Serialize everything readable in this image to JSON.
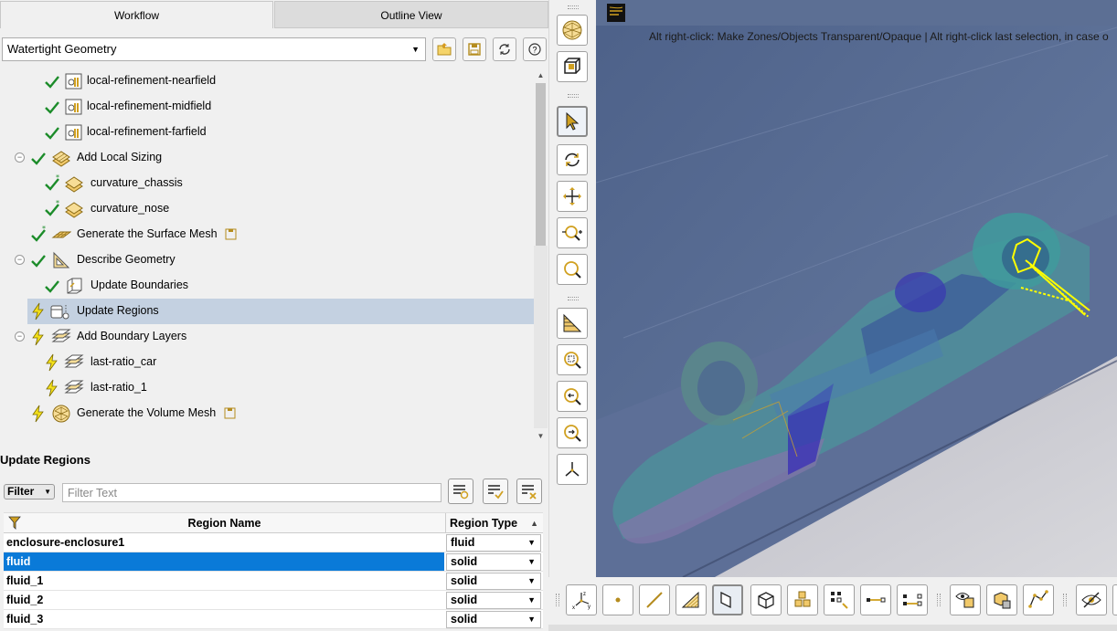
{
  "tabs": {
    "workflow": "Workflow",
    "outline": "Outline View"
  },
  "workflow_select": {
    "value": "Watertight Geometry"
  },
  "toolbar_icons": [
    "open-folder-icon",
    "save-icon",
    "refresh-icon",
    "help-icon"
  ],
  "tree": [
    {
      "label": "local-refinement-nearfield",
      "status": "check",
      "icon": "refinement-icon"
    },
    {
      "label": "local-refinement-midfield",
      "status": "check",
      "icon": "refinement-icon"
    },
    {
      "label": "local-refinement-farfield",
      "status": "check",
      "icon": "refinement-icon"
    },
    {
      "label": "Add Local Sizing",
      "status": "check",
      "icon": "sizing-icon"
    },
    {
      "label": "curvature_chassis",
      "status": "check-star",
      "icon": "sizing-icon"
    },
    {
      "label": "curvature_nose",
      "status": "check-star",
      "icon": "sizing-icon"
    },
    {
      "label": "Generate the Surface Mesh",
      "status": "check-star",
      "icon": "surface-mesh-icon"
    },
    {
      "label": "Describe Geometry",
      "status": "check",
      "icon": "geometry-icon"
    },
    {
      "label": "Update Boundaries",
      "status": "check",
      "icon": "boundaries-icon"
    },
    {
      "label": "Update Regions",
      "status": "lightning",
      "icon": "regions-icon"
    },
    {
      "label": "Add Boundary Layers",
      "status": "lightning",
      "icon": "layers-icon"
    },
    {
      "label": "last-ratio_car",
      "status": "lightning",
      "icon": "layers-icon"
    },
    {
      "label": "last-ratio_1",
      "status": "lightning",
      "icon": "layers-icon"
    },
    {
      "label": "Generate the Volume Mesh",
      "status": "lightning",
      "icon": "volume-mesh-icon"
    }
  ],
  "panel": {
    "title": "Update Regions",
    "filter_label": "Filter",
    "filter_placeholder": "Filter Text",
    "columns": {
      "name": "Region Name",
      "type": "Region Type"
    },
    "rows": [
      {
        "name": "enclosure-enclosure1",
        "type": "fluid"
      },
      {
        "name": "fluid",
        "type": "solid"
      },
      {
        "name": "fluid_1",
        "type": "solid"
      },
      {
        "name": "fluid_2",
        "type": "solid"
      },
      {
        "name": "fluid_3",
        "type": "solid"
      }
    ]
  },
  "viewport": {
    "hint": "Alt right-click: Make Zones/Objects Transparent/Opaque | Alt right-click last selection, in case o",
    "colors": {
      "background": "#5a6e92",
      "floor": "#c9c9cf",
      "car_body": "#4d8f9a",
      "highlight": "#ffff00"
    }
  }
}
